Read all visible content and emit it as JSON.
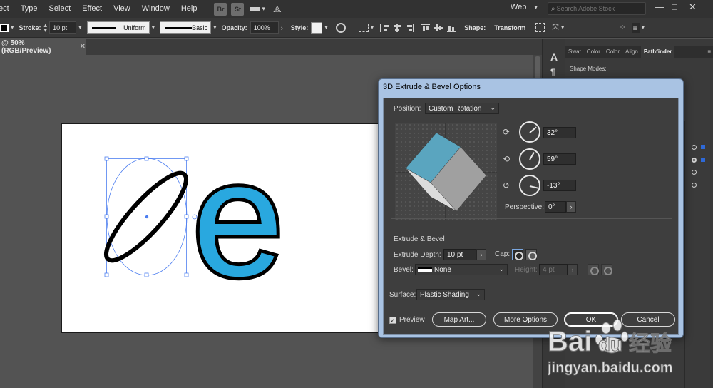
{
  "menubar": {
    "items": [
      "ect",
      "Type",
      "Select",
      "Effect",
      "View",
      "Window",
      "Help"
    ],
    "icons": [
      "Br",
      "St"
    ],
    "workspace": "Web",
    "search_placeholder": "Search Adobe Stock"
  },
  "control_bar": {
    "stroke_label": "Stroke:",
    "stroke_value": "10 pt",
    "profile": "Uniform",
    "brush": "Basic",
    "opacity_label": "Opacity:",
    "opacity_value": "100%",
    "style_label": "Style:",
    "shape_label": "Shape:",
    "transform_label": "Transform"
  },
  "document_tab": {
    "title": "@ 50% (RGB/Preview)",
    "close": "✕"
  },
  "right_panel": {
    "tabs": [
      "Swat",
      "Color",
      "Color",
      "Align",
      "Pathfinder"
    ],
    "active_tab": "Pathfinder",
    "subheading": "Shape Modes:",
    "tool_glyphs": [
      "A",
      "¶"
    ]
  },
  "dialog": {
    "title": "3D Extrude & Bevel Options",
    "position_label": "Position:",
    "position_value": "Custom Rotation",
    "rot_x": "32°",
    "rot_y": "59°",
    "rot_z": "-13°",
    "perspective_label": "Perspective:",
    "perspective_value": "0°",
    "extrude_section": "Extrude & Bevel",
    "extrude_depth_label": "Extrude Depth:",
    "extrude_depth_value": "10 pt",
    "cap_label": "Cap:",
    "bevel_label": "Bevel:",
    "bevel_value": "None",
    "height_label": "Height:",
    "height_value": "4 pt",
    "surface_label": "Surface:",
    "surface_value": "Plastic Shading",
    "preview_label": "Preview",
    "preview_checked": true,
    "map_art_label": "Map Art...",
    "more_options_label": "More Options",
    "ok_label": "OK",
    "cancel_label": "Cancel"
  },
  "artwork": {
    "letter": "e",
    "letter_fill": "#29a8df",
    "cube_top": "#5aa5bf",
    "cube_right": "#a0a0a0",
    "cube_left": "#dcdcdc"
  },
  "watermark": {
    "brand": "Bai",
    "brand2": "du",
    "cn": "经验",
    "url": "jingyan.baidu.com"
  }
}
